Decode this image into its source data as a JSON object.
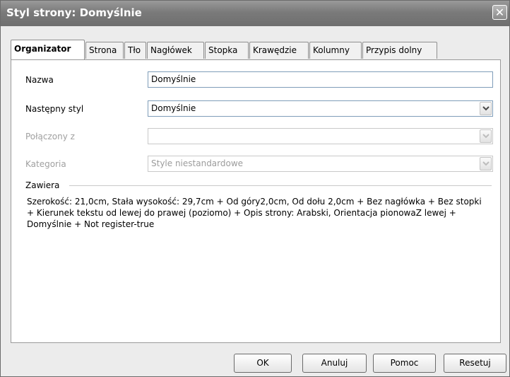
{
  "window": {
    "title": "Styl strony: Domyślnie",
    "close_glyph": "✕"
  },
  "tabs": [
    {
      "label": "Organizator",
      "active": true
    },
    {
      "label": "Strona"
    },
    {
      "label": "Tło"
    },
    {
      "label": "Nagłówek"
    },
    {
      "label": "Stopka"
    },
    {
      "label": "Krawędzie"
    },
    {
      "label": "Kolumny"
    },
    {
      "label": "Przypis dolny"
    }
  ],
  "form": {
    "name_label": "Nazwa",
    "name_value": "Domyślnie",
    "next_style_label": "Następny styl",
    "next_style_value": "Domyślnie",
    "linked_label": "Połączony z",
    "linked_value": "",
    "category_label": "Kategoria",
    "category_value": "Style niestandardowe"
  },
  "contains": {
    "label": "Zawiera",
    "text": "Szerokość: 21,0cm, Stała wysokość: 29,7cm + Od góry2,0cm, Od dołu 2,0cm + Bez nagłówka + Bez stopki + Kierunek tekstu od lewej do prawej (poziomo) + Opis strony: Arabski, Orientacja pionowaZ lewej + Domyślnie + Not register-true"
  },
  "buttons": {
    "ok": "OK",
    "cancel": "Anuluj",
    "help": "Pomoc",
    "reset": "Resetuj"
  }
}
